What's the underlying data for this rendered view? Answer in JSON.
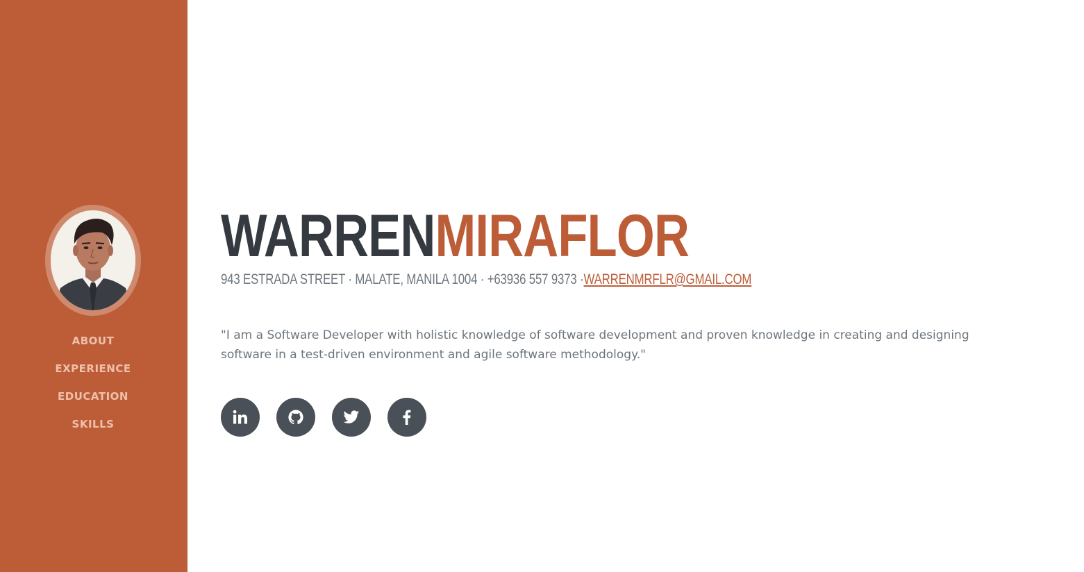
{
  "profile": {
    "first_name": "WARREN",
    "last_name": "MIRAFLOR",
    "address": "943 ESTRADA STREET · MALATE, MANILA 1004 · +63936 557 9373 ·",
    "email": "WARRENMRFLR@GMAIL.COM",
    "bio": "\"I am a Software Developer with holistic knowledge of software development and proven knowledge in creating and designing software in a test-driven environment and agile software methodology.\""
  },
  "nav": {
    "items": [
      {
        "label": "ABOUT"
      },
      {
        "label": "EXPERIENCE"
      },
      {
        "label": "EDUCATION"
      },
      {
        "label": "SKILLS"
      }
    ]
  },
  "socials": [
    {
      "icon": "linkedin-icon"
    },
    {
      "icon": "github-icon"
    },
    {
      "icon": "twitter-icon"
    },
    {
      "icon": "facebook-icon"
    }
  ],
  "colors": {
    "sidebar": "#bd5d38",
    "accent": "#bd5d38",
    "heading": "#343a40",
    "text": "#6c757d",
    "social_bg": "#495057"
  }
}
